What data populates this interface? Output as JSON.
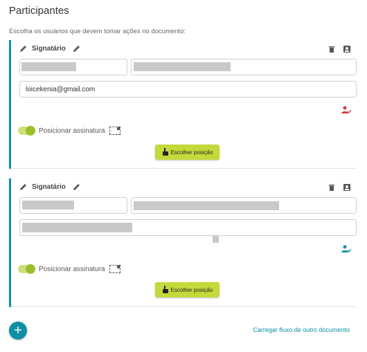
{
  "page": {
    "title": "Participantes",
    "subtitle": "Escolha os usuários que devem tomar ações no documento:"
  },
  "participants": [
    {
      "role": "Signatário",
      "email": "loicekenia@gmail.com",
      "toggle_label": "Posicionar assinatura",
      "position_button": "Escolher posição",
      "status_color": "#d23c3c"
    },
    {
      "role": "Signatário",
      "email": "",
      "toggle_label": "Posicionar assinatura",
      "position_button": "Escolher posição",
      "status_color": "#0e8fa8"
    }
  ],
  "footer": {
    "add_button": "+",
    "load_flow_link": "Carregar fluxo de outro documento"
  },
  "colors": {
    "accent": "#0e8fa8",
    "button": "#c5d93a",
    "toggle": "#9bbf2c"
  }
}
